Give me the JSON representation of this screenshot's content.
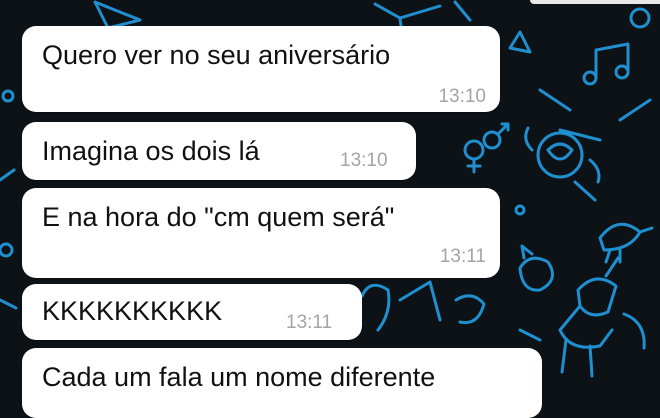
{
  "chat": {
    "messages": [
      {
        "text": "Quero ver no seu aniversário",
        "time": "13:10"
      },
      {
        "text": "Imagina os dois lá",
        "time": "13:10"
      },
      {
        "text": "E na hora do \"cm quem será\"",
        "time": "13:11"
      },
      {
        "text": "KKKKKKKKKK",
        "time": "13:11"
      },
      {
        "text": "Cada um fala um nome diferente",
        "time": ""
      }
    ]
  },
  "wallpaper": {
    "background_color": "#0d1216",
    "doodle_color": "#1f8fd0",
    "icons": [
      "music-note-icon",
      "rose-icon",
      "bird-icon",
      "unicorn-icon",
      "gender-symbols-icon",
      "paper-plane-icon",
      "cat-icon",
      "gift-icon"
    ]
  }
}
